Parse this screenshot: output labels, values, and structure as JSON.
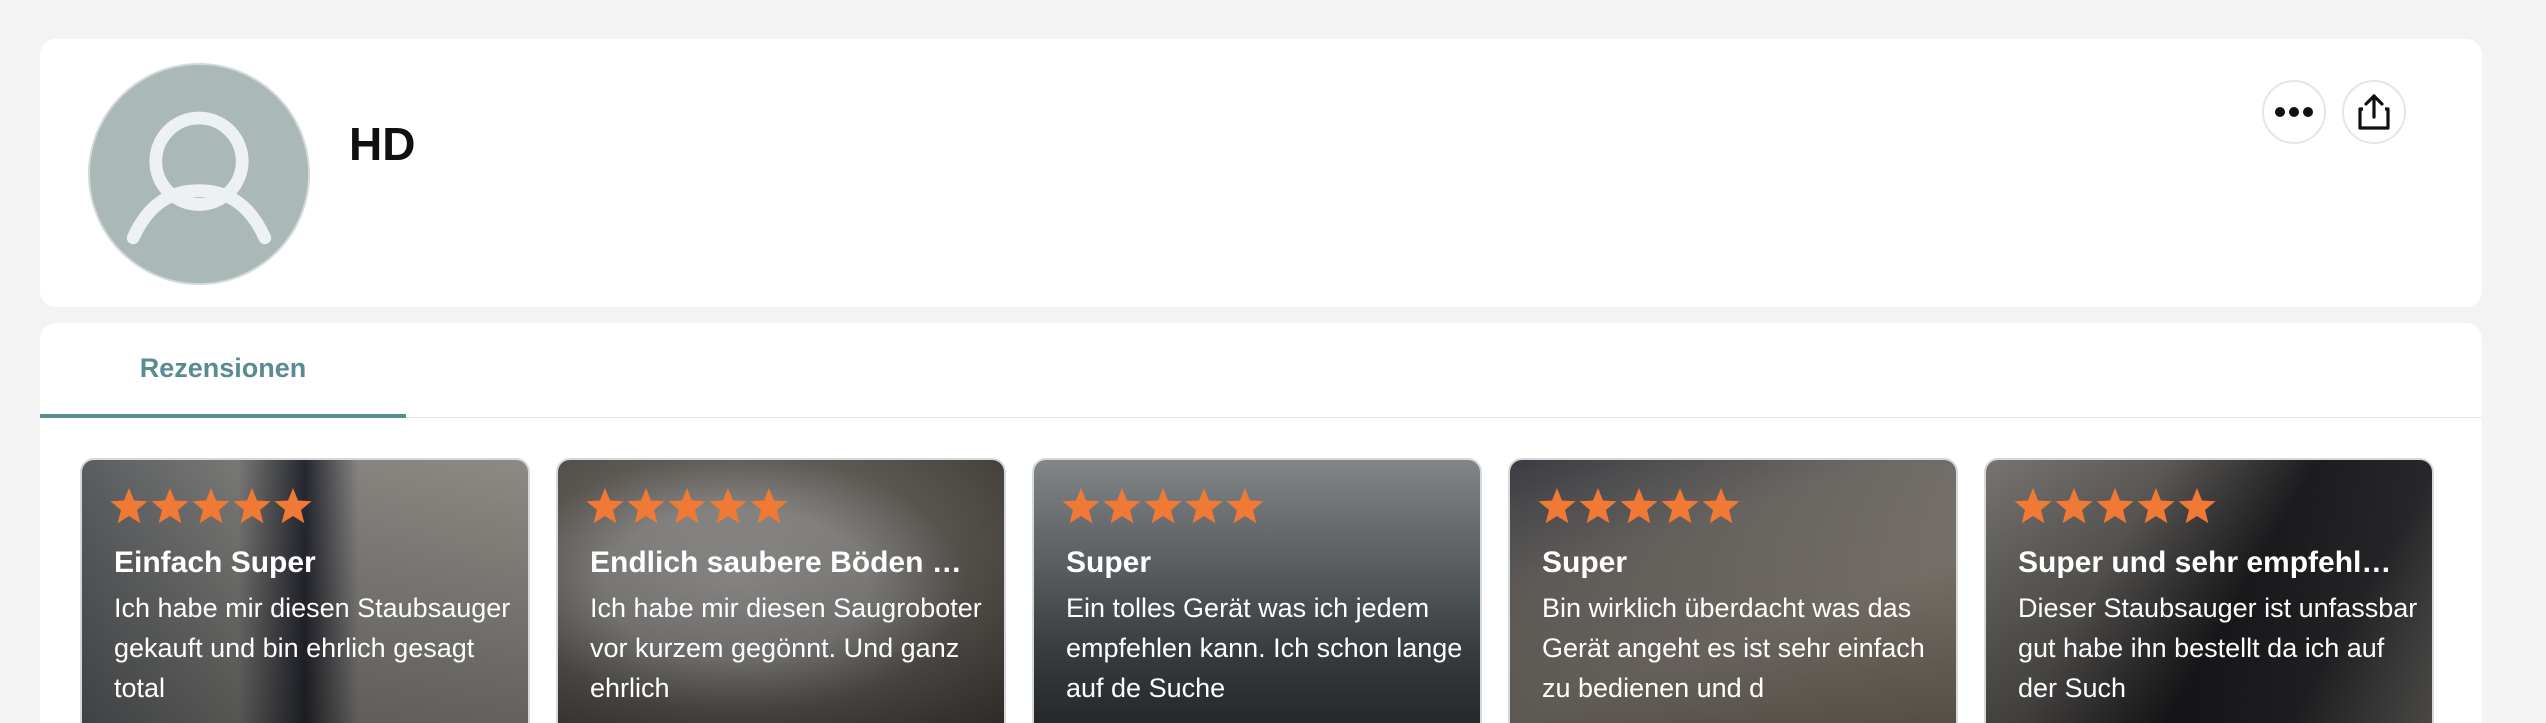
{
  "profile": {
    "name": "HD",
    "actions": {
      "more_icon": "more-dots-icon",
      "share_icon": "share-icon"
    }
  },
  "tabs": [
    {
      "label": "Rezensionen",
      "active": true
    }
  ],
  "reviews": [
    {
      "rating": 5,
      "title": "Einfach Super",
      "body": "Ich habe mir diesen Staubsauger gekauft und bin ehrlich gesagt total"
    },
    {
      "rating": 5,
      "title": "Endlich saubere Böden …",
      "body": "Ich habe mir diesen Saugroboter vor kurzem gegönnt. Und ganz ehrlich"
    },
    {
      "rating": 5,
      "title": "Super",
      "body": "Ein tolles Gerät was ich jedem empfehlen kann. Ich schon lange auf de Suche"
    },
    {
      "rating": 5,
      "title": "Super",
      "body": "Bin wirklich überdacht was das Gerät angeht es ist sehr einfach zu bedienen und d"
    },
    {
      "rating": 5,
      "title": "Super und sehr empfehl…",
      "body": "Dieser Staubsauger ist unfassbar gut habe ihn bestellt da ich auf der Such"
    }
  ],
  "colors": {
    "star": "#f07a35",
    "tab_accent": "#5a8a94",
    "avatar_bg": "#aab8b8"
  }
}
